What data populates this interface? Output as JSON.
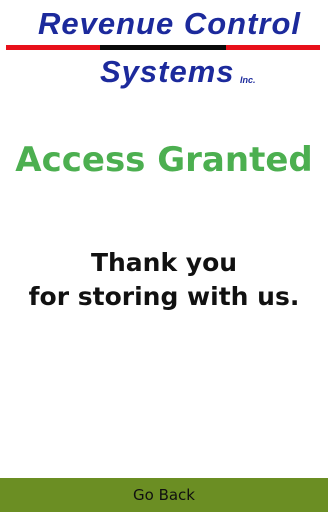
{
  "logo": {
    "line1": "Revenue  Control",
    "line2": "Systems",
    "suffix": "Inc.",
    "colors": {
      "text": "#1c2a9c",
      "bar_red": "#e8101a",
      "bar_black": "#0a0a0a"
    }
  },
  "status": {
    "title": "Access Granted",
    "color": "#4caf50"
  },
  "message": {
    "line1": "Thank you",
    "line2": "for storing with us."
  },
  "footer": {
    "button_label": "Go Back",
    "button_color": "#6b8e23"
  }
}
